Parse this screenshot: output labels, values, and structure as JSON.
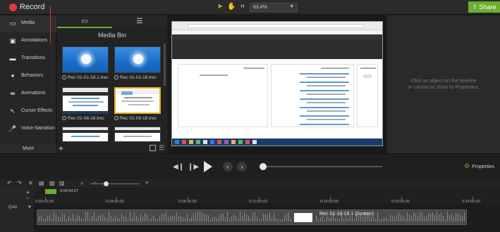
{
  "toolbar": {
    "title": "Record",
    "zoom": "63.4%",
    "share": "Share"
  },
  "nav": {
    "items": [
      {
        "label": "Media",
        "icon": "media-icon"
      },
      {
        "label": "Annotations",
        "icon": "annotations-icon"
      },
      {
        "label": "Transitions",
        "icon": "transitions-icon"
      },
      {
        "label": "Behaviors",
        "icon": "behaviors-icon"
      },
      {
        "label": "Animations",
        "icon": "animations-icon"
      },
      {
        "label": "Cursor Effects",
        "icon": "cursor-effects-icon"
      },
      {
        "label": "Voice Narration",
        "icon": "voice-narration-icon"
      }
    ],
    "more": "More"
  },
  "media_bin": {
    "title": "Media Bin",
    "items": [
      {
        "caption": "Rec 01-01-18.1.trec"
      },
      {
        "caption": "Rec 01-01-18.trec"
      },
      {
        "caption": "Rec 01-08-18.trec"
      },
      {
        "caption": "Rec 01-09-18.trec"
      }
    ]
  },
  "properties": {
    "message_line1": "Click an object on the timeline",
    "message_line2": "or canvas to show its Properties.",
    "button": "Properties"
  },
  "timeline": {
    "playhead_time": "0:00:54;27",
    "track_name": "Quiz",
    "ruler": [
      "0:00:00;00",
      "0:04:00;00",
      "0:08:00;00",
      "0:12:00;00",
      "0:16:00;00",
      "0:20:00;00",
      "0:24:00;00"
    ],
    "clip_label": "Rec 01-18-18.1 (Screen)"
  },
  "colors": {
    "accent": "#6cae2f",
    "record": "#e03a3a",
    "selection": "#e8b21b"
  }
}
